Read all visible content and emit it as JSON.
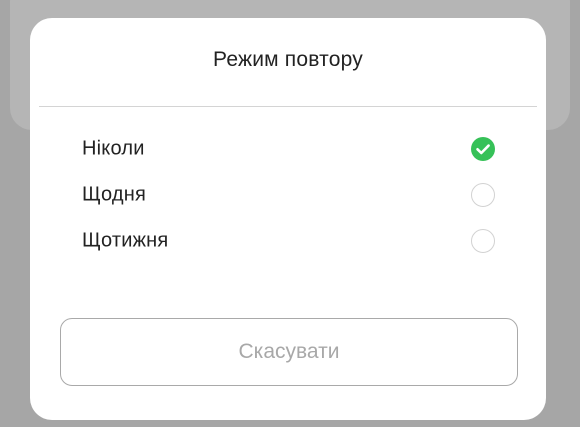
{
  "dialog": {
    "title": "Режим повтору",
    "options": [
      {
        "label": "Ніколи",
        "selected": true
      },
      {
        "label": "Щодня",
        "selected": false
      },
      {
        "label": "Щотижня",
        "selected": false
      }
    ],
    "cancel_label": "Скасувати"
  },
  "colors": {
    "accent": "#36c158",
    "overlay": "#a6a6a6",
    "surface": "#ffffff"
  },
  "icons": {
    "selected": "check-circle-icon",
    "unselected": "radio-empty-icon"
  }
}
